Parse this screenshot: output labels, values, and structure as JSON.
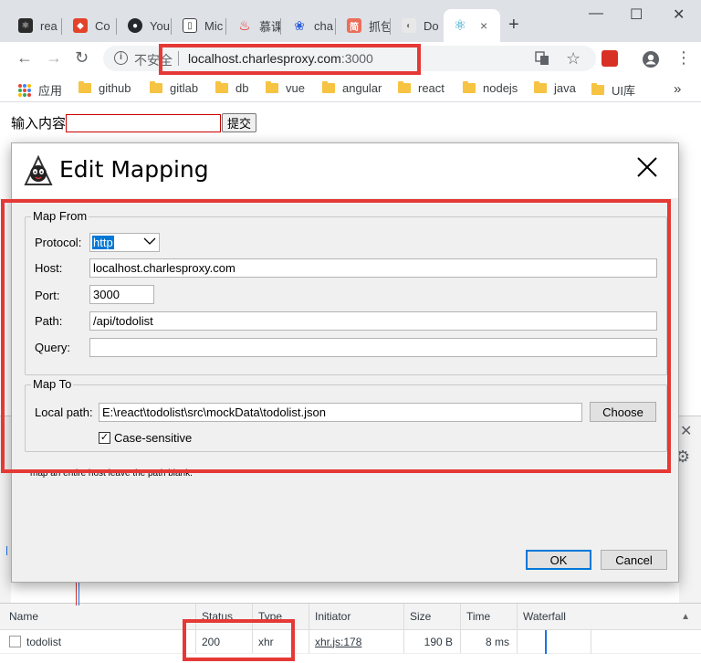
{
  "tabs": [
    {
      "label": "rea",
      "icon": "react-icon",
      "color": "#222"
    },
    {
      "label": "Co",
      "icon": "gitlab-icon",
      "color": "#e24329"
    },
    {
      "label": "You",
      "icon": "github-icon",
      "color": "#24292e"
    },
    {
      "label": "Mic",
      "icon": "book-icon",
      "color": "#444"
    },
    {
      "label": "慕课",
      "icon": "flame-icon",
      "color": "#f01414"
    },
    {
      "label": "cha",
      "icon": "paw-icon",
      "color": "#2d5fde"
    },
    {
      "label": "抓包",
      "icon": "jian-icon",
      "color": "#ea6f5a"
    },
    {
      "label": "Do",
      "icon": "doc-icon",
      "color": "#999"
    },
    {
      "label": "",
      "icon": "react-icon",
      "color": "#61dafb",
      "active": true
    }
  ],
  "tab_close": "×",
  "new_tab": "+",
  "window_controls": {
    "minimize": "—",
    "maximize": "☐",
    "close": "✕"
  },
  "toolbar": {
    "back": "←",
    "forward": "→",
    "reload": "↻",
    "info_symbol": "i",
    "insecure_label": "不安全",
    "url_host": "localhost.charlesproxy.com",
    "url_port": ":3000",
    "star": "☆",
    "menu": "⋮"
  },
  "bookmarks": {
    "apps_label": "应用",
    "items": [
      "github",
      "gitlab",
      "db",
      "vue",
      "angular",
      "react",
      "nodejs",
      "java",
      "UI库"
    ],
    "overflow": "»"
  },
  "page": {
    "input_label": "输入内容",
    "submit_label": "提交"
  },
  "dialog": {
    "title": "Edit Mapping",
    "close": "×",
    "map_from": {
      "legend": "Map From",
      "protocol_label": "Protocol:",
      "protocol_value": "http",
      "host_label": "Host:",
      "host_value": "localhost.charlesproxy.com",
      "port_label": "Port:",
      "port_value": "3000",
      "path_label": "Path:",
      "path_value": "/api/todolist",
      "query_label": "Query:",
      "query_value": ""
    },
    "map_to": {
      "legend": "Map To",
      "local_path_label": "Local path:",
      "local_path_value": "E:\\react\\todolist\\src\\mockData\\todolist.json",
      "choose_label": "Choose",
      "case_sensitive_label": "Case-sensitive",
      "case_sensitive_checked": true
    },
    "help_text": "map an entire host leave the path blank.",
    "ok_label": "OK",
    "cancel_label": "Cancel"
  },
  "devtools": {
    "close": "✕",
    "settings": "⚙",
    "columns": [
      "Name",
      "Status",
      "Type",
      "Initiator",
      "Size",
      "Time",
      "Waterfall"
    ],
    "sort_indicator": "▲",
    "rows": [
      {
        "name": "todolist",
        "status": "200",
        "type": "xhr",
        "initiator": "xhr.js:178",
        "size": "190 B",
        "time": "8 ms"
      }
    ]
  },
  "annotation_color": "#e53935"
}
